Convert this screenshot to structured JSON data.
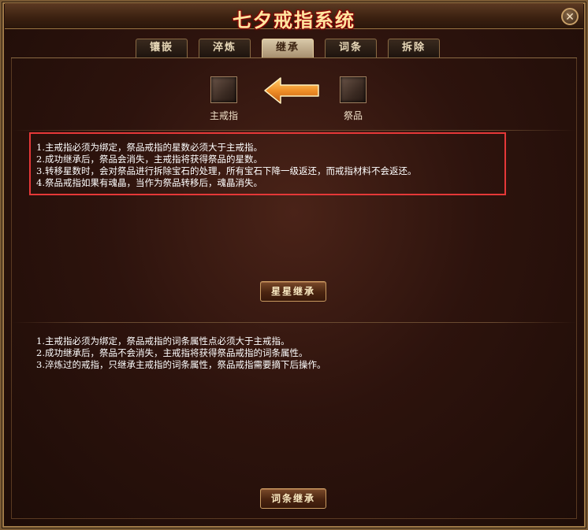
{
  "window": {
    "title": "七夕戒指系统",
    "close_icon": "close-icon"
  },
  "tabs": [
    {
      "label": "镶嵌",
      "active": false
    },
    {
      "label": "淬炼",
      "active": false
    },
    {
      "label": "继承",
      "active": true
    },
    {
      "label": "词条",
      "active": false
    },
    {
      "label": "拆除",
      "active": false
    }
  ],
  "inherit": {
    "main_slot_label": "主戒指",
    "sacrifice_slot_label": "祭品",
    "arrow_icon": "arrow-left-icon"
  },
  "star_rules": [
    "1.主戒指必须为绑定，祭品戒指的星数必须大于主戒指。",
    "2.成功继承后，祭品会消失，主戒指将获得祭品的星数。",
    "3.转移星数时，会对祭品进行拆除宝石的处理，所有宝石下降一级返还，而戒指材料不会返还。",
    "4.祭品戒指如果有魂晶，当作为祭品转移后，魂晶消失。"
  ],
  "star_button": "星星继承",
  "affix_rules": [
    "1.主戒指必须为绑定，祭品戒指的词条属性点必须大于主戒指。",
    "2.成功继承后，祭品不会消失，主戒指将获得祭品戒指的词条属性。",
    "3.淬炼过的戒指，只继承主戒指的词条属性，祭品戒指需要摘下后操作。"
  ],
  "affix_button": "词条继承",
  "colors": {
    "highlight_border": "#e53838",
    "accent_gold": "#ffe6a0",
    "panel_bg": "#2d130d"
  }
}
